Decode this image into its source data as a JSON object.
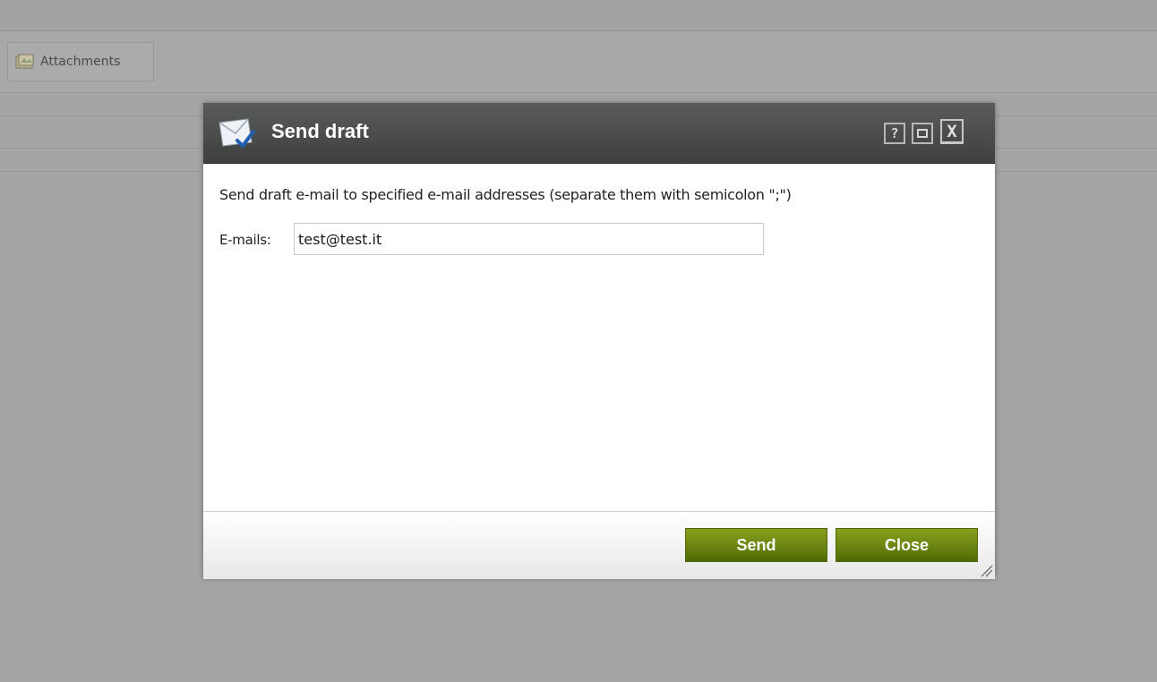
{
  "background": {
    "toolbar": {
      "attachments_label": "Attachments"
    }
  },
  "dialog": {
    "title": "Send draft",
    "header_icon": "envelope-check-icon",
    "window_controls": {
      "help": "?",
      "maximize": "maximize-icon",
      "close": "X"
    },
    "instructions": "Send draft e-mail to specified e-mail addresses (separate them with semicolon \";\")",
    "emails_label": "E-mails:",
    "emails_value": "test@test.it",
    "buttons": {
      "send": "Send",
      "close": "Close"
    }
  },
  "colors": {
    "header": "#4a4c4b",
    "button_green": "#6a8410",
    "overlay_gray": "#a5a5a5"
  }
}
